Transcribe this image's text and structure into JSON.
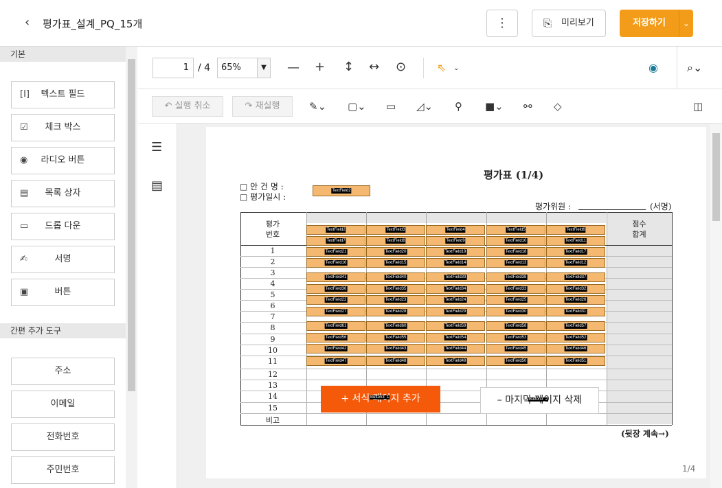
{
  "header": {
    "title": "평가표_설계_PQ_15개",
    "back_icon": "‹",
    "more_icon": "⋮",
    "preview_label": "미리보기",
    "save_label": "저장하기",
    "save_dropdown_icon": "⌄"
  },
  "left_panel": {
    "section_basic": "기본",
    "tools": [
      {
        "icon": "[I]",
        "label": "텍스트 필드"
      },
      {
        "icon": "☑",
        "label": "체크 박스"
      },
      {
        "icon": "◉",
        "label": "라디오 버튼"
      },
      {
        "icon": "▤",
        "label": "목록 상자"
      },
      {
        "icon": "▭",
        "label": "드롭 다운"
      },
      {
        "icon": "✍",
        "label": "서명"
      },
      {
        "icon": "▣",
        "label": "버튼"
      }
    ],
    "section_quick": "간편 추가 도구",
    "quick_tools": [
      "주소",
      "이메일",
      "전화번호",
      "주민번호"
    ]
  },
  "toolbar": {
    "page_current": "1",
    "page_total": "/ 4",
    "zoom": "65%",
    "undo_label": "실행 취소",
    "redo_label": "재실행"
  },
  "document": {
    "title": "평가표 (1/4)",
    "item_label": "□ 안 건 명 :",
    "date_label": "□ 평가일시 :",
    "evaluator_label": "평가위원 :",
    "sign_label": "(서명)",
    "col_eval_no": "평가\n번호",
    "col_score": "점수\n합계",
    "row_numbers": [
      "1",
      "2",
      "3",
      "4",
      "5",
      "6",
      "7",
      "8",
      "9",
      "10",
      "11",
      "12",
      "13",
      "14",
      "15",
      "비고"
    ],
    "top_field": "TextField2",
    "header_fields": [
      [
        "TextField2",
        "TextField3",
        "TextField4",
        "TextField5",
        "TextField6"
      ],
      [
        "TextField7",
        "TextField8",
        "TextField9",
        "TextField10",
        "TextField11"
      ]
    ],
    "body_fields": [
      [
        "TextField21",
        "TextField20",
        "TextField19",
        "TextField18",
        "TextField17"
      ],
      [
        "TextField16",
        "TextField15",
        "TextField14",
        "TextField13",
        "TextField12"
      ],
      [
        "TextField41",
        "TextField40",
        "TextField39",
        "TextField38",
        "TextField37"
      ],
      [
        "TextField36",
        "TextField35",
        "TextField34",
        "TextField33",
        "TextField32"
      ],
      [
        "TextField22",
        "TextField23",
        "TextField24",
        "TextField25",
        "TextField26"
      ],
      [
        "TextField27",
        "TextField28",
        "TextField29",
        "TextField30",
        "TextField31"
      ],
      [
        "TextField61",
        "TextField60",
        "TextField59",
        "TextField58",
        "TextField57"
      ],
      [
        "TextField56",
        "TextField55",
        "TextField54",
        "TextField53",
        "TextField52"
      ],
      [
        "TextField42",
        "TextField43",
        "TextField44",
        "TextField45",
        "TextField46"
      ],
      [
        "TextField47",
        "TextField48",
        "TextField49",
        "TextField50",
        "TextField51"
      ]
    ],
    "add_page_label": "+ 서식 페이지 추가",
    "add_button_field": "Button3_1",
    "delete_page_label": "– 마지막 페이지 삭제",
    "delete_button_field": "Button3_2",
    "continue_label": "(뒷장 계속→)",
    "page_indicator": "1/4"
  },
  "colors": {
    "accent": "#f39c1a",
    "field_fill": "#f5b870",
    "add_button": "#f55a0a",
    "eye": "#1a7a9a"
  }
}
